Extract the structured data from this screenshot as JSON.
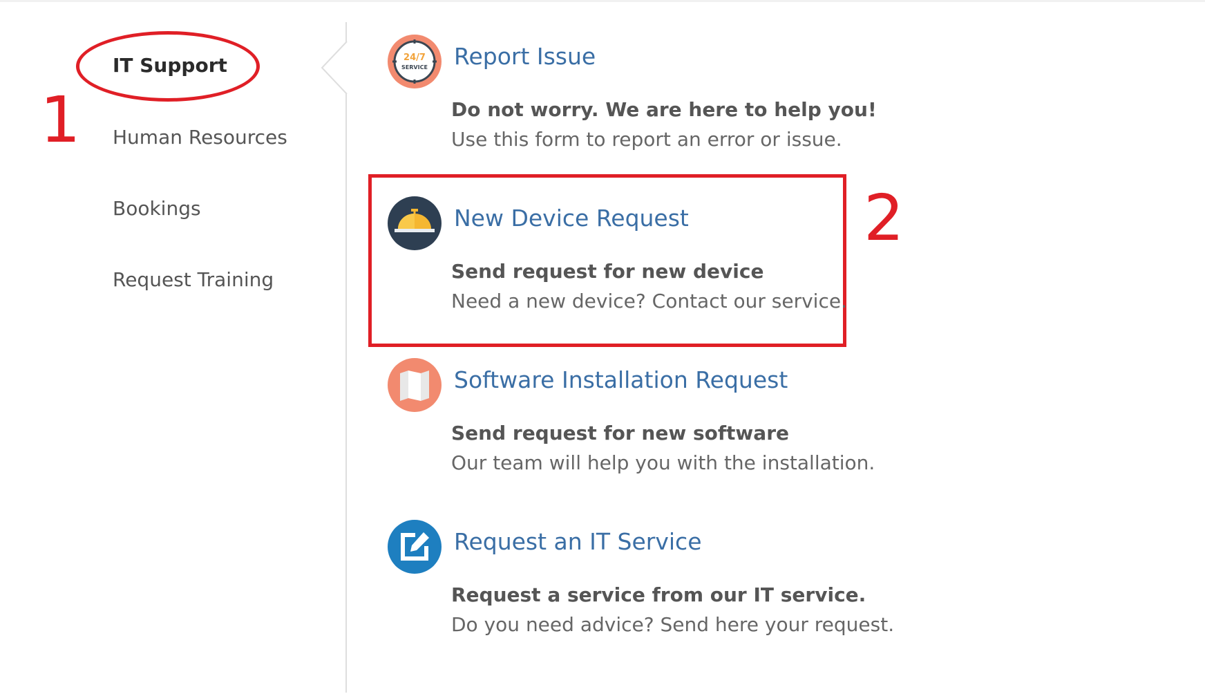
{
  "sidebar": {
    "items": [
      {
        "label": "IT Support",
        "active": true
      },
      {
        "label": "Human Resources",
        "active": false
      },
      {
        "label": "Bookings",
        "active": false
      },
      {
        "label": "Request Training",
        "active": false
      }
    ]
  },
  "annotations": {
    "marker_1": "1",
    "marker_2": "2",
    "color": "#e01f26"
  },
  "services": [
    {
      "icon": "24-7-service-icon",
      "icon_text_top": "24/7",
      "icon_text_bottom": "SERVICE",
      "title": "Report Issue",
      "subtitle": "Do not worry. We are here to help you!",
      "description": "Use this form to report an error or issue."
    },
    {
      "icon": "service-bell-icon",
      "title": "New Device Request",
      "subtitle": "Send request for new device",
      "description": "Need a new device? Contact our service."
    },
    {
      "icon": "map-icon",
      "title": "Software Installation Request",
      "subtitle": "Send request for new software",
      "description": "Our team will help you with the installation."
    },
    {
      "icon": "edit-icon",
      "title": "Request an IT Service",
      "subtitle": "Request a service from our IT service.",
      "description": "Do you need advice? Send here your request."
    }
  ],
  "colors": {
    "link": "#3a6ea5",
    "text_dark": "#555555",
    "text_muted": "#666666",
    "icon_salmon": "#f28a6f",
    "icon_navy": "#2e3f52",
    "icon_blue": "#1e7fc0",
    "bell_yellow": "#f5b731"
  }
}
